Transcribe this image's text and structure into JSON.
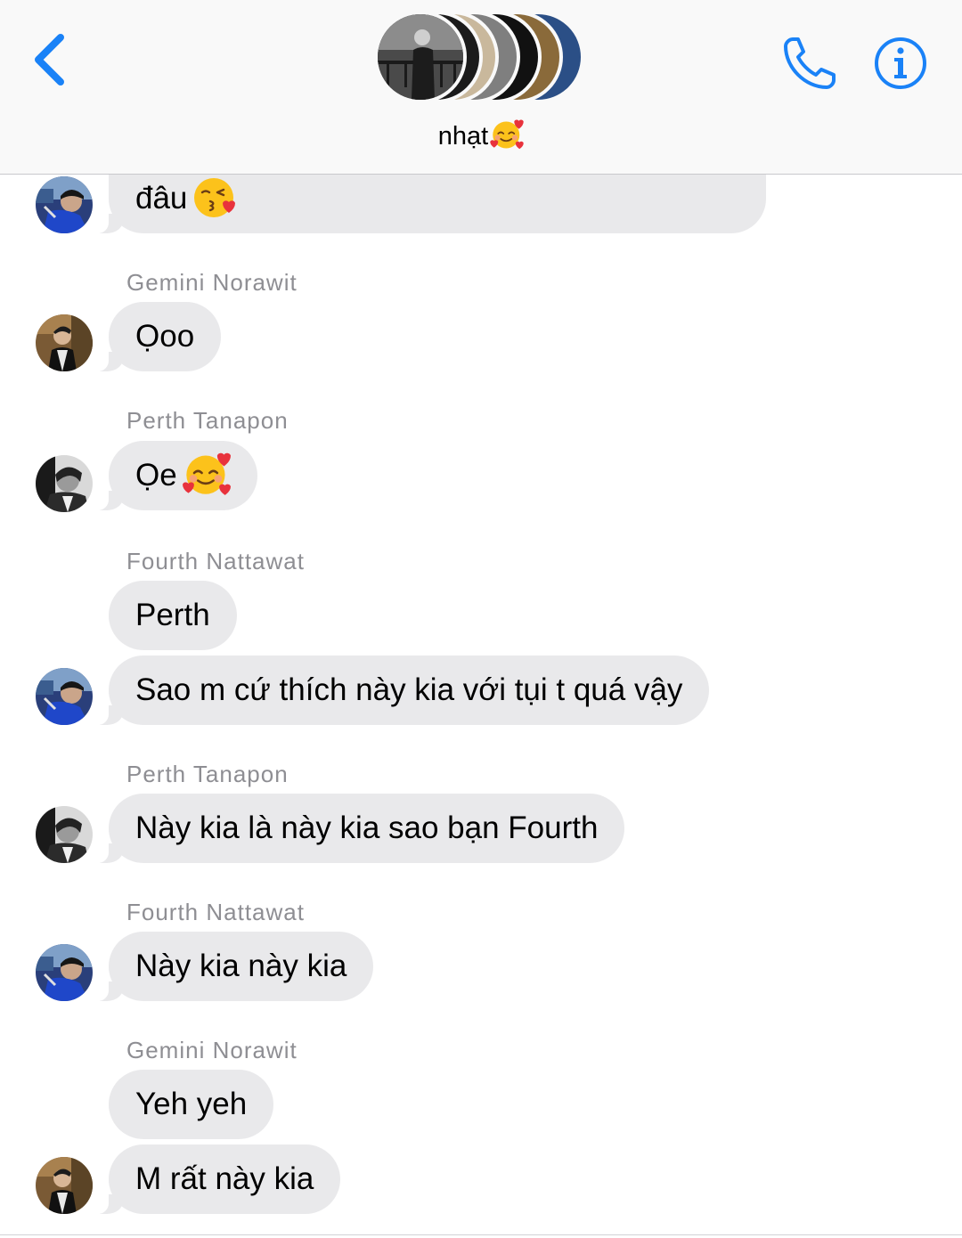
{
  "header": {
    "group_name": "nhạt",
    "group_emoji": "smiling-face-with-hearts"
  },
  "messages": [
    {
      "text": "đâu",
      "emoji": "face-blowing-kiss",
      "avatar": "fourth"
    },
    {
      "sender": "Gemini Norawit"
    },
    {
      "text": "Ọoo",
      "avatar": "gemini"
    },
    {
      "sender": "Perth Tanapon"
    },
    {
      "text": "Ọe",
      "emoji": "smiling-face-with-hearts",
      "avatar": "perth"
    },
    {
      "sender": "Fourth Nattawat"
    },
    {
      "text": "Perth"
    },
    {
      "text": "Sao m cứ thích này kia với tụi t quá vậy",
      "avatar": "fourth"
    },
    {
      "sender": "Perth Tanapon"
    },
    {
      "text": "Này kia là này kia sao bạn Fourth",
      "avatar": "perth"
    },
    {
      "sender": "Fourth Nattawat"
    },
    {
      "text": "Này kia này kia",
      "avatar": "fourth"
    },
    {
      "sender": "Gemini Norawit"
    },
    {
      "text": "Yeh yeh"
    },
    {
      "text": "M rất này kia",
      "avatar": "gemini"
    }
  ],
  "colors": {
    "ios_blue": "#1a82f7",
    "bubble_gray": "#e9e9eb",
    "sender_gray": "#8e8e93"
  }
}
